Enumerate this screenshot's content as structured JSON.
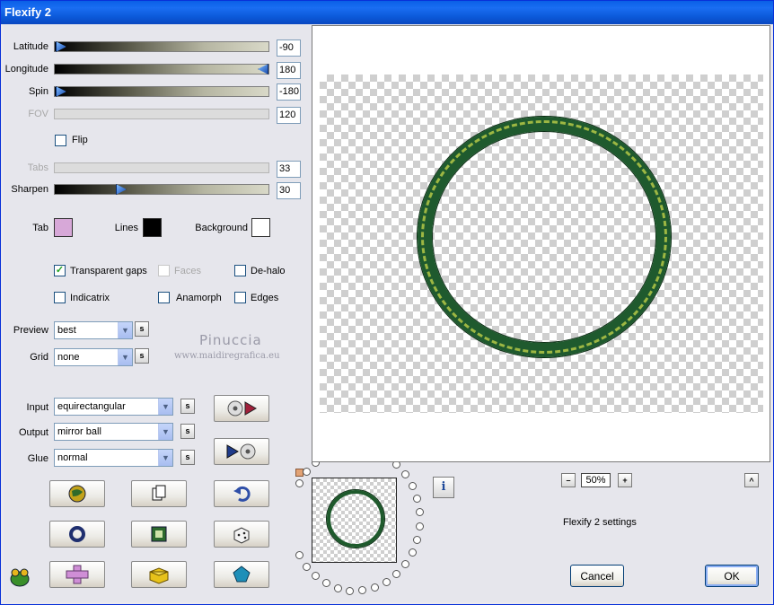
{
  "window": {
    "title": "Flexify 2"
  },
  "sliders": [
    {
      "label": "Latitude",
      "value": "-90",
      "level": 0.0,
      "enabled": true
    },
    {
      "label": "Longitude",
      "value": "180",
      "level": 1.0,
      "enabled": true
    },
    {
      "label": "Spin",
      "value": "-180",
      "level": 0.0,
      "enabled": true
    },
    {
      "label": "FOV",
      "value": "120",
      "level": null,
      "enabled": false
    },
    {
      "label": "Tabs",
      "value": "33",
      "level": null,
      "enabled": false
    },
    {
      "label": "Sharpen",
      "value": "30",
      "level": 0.3,
      "enabled": true
    }
  ],
  "flip": {
    "label": "Flip",
    "checked": false
  },
  "colors": {
    "tab": {
      "label": "Tab",
      "hex": "#d7a8d8"
    },
    "lines": {
      "label": "Lines",
      "hex": "#000000"
    },
    "background": {
      "label": "Background",
      "hex": "#ffffff"
    }
  },
  "options": {
    "transparent_gaps": {
      "label": "Transparent gaps",
      "checked": true
    },
    "faces": {
      "label": "Faces",
      "checked": false
    },
    "de_halo": {
      "label": "De-halo",
      "checked": false
    },
    "indicatrix": {
      "label": "Indicatrix",
      "checked": false
    },
    "anamorph": {
      "label": "Anamorph",
      "checked": false
    },
    "edges": {
      "label": "Edges",
      "checked": false
    }
  },
  "preview_select": {
    "label": "Preview",
    "value": "best"
  },
  "grid_select": {
    "label": "Grid",
    "value": "none"
  },
  "input_select": {
    "label": "Input",
    "value": "equirectangular"
  },
  "output_select": {
    "label": "Output",
    "value": "mirror ball"
  },
  "glue_select": {
    "label": "Glue",
    "value": "normal"
  },
  "small_button_label": "s",
  "watermark": {
    "line1": "Pinuccia",
    "line2": "www.maidiregrafica.eu"
  },
  "zoom": {
    "minus": "–",
    "value": "50%",
    "plus": "+",
    "collapse": "^"
  },
  "settings_name": "Flexify 2 settings",
  "buttons": {
    "cancel": "Cancel",
    "ok": "OK"
  },
  "info_icon": "i",
  "accent_colors": {
    "ring": "#1e5a2c",
    "ring_highlight": "#c8d64a",
    "title_bar": "#0a5fe6"
  }
}
